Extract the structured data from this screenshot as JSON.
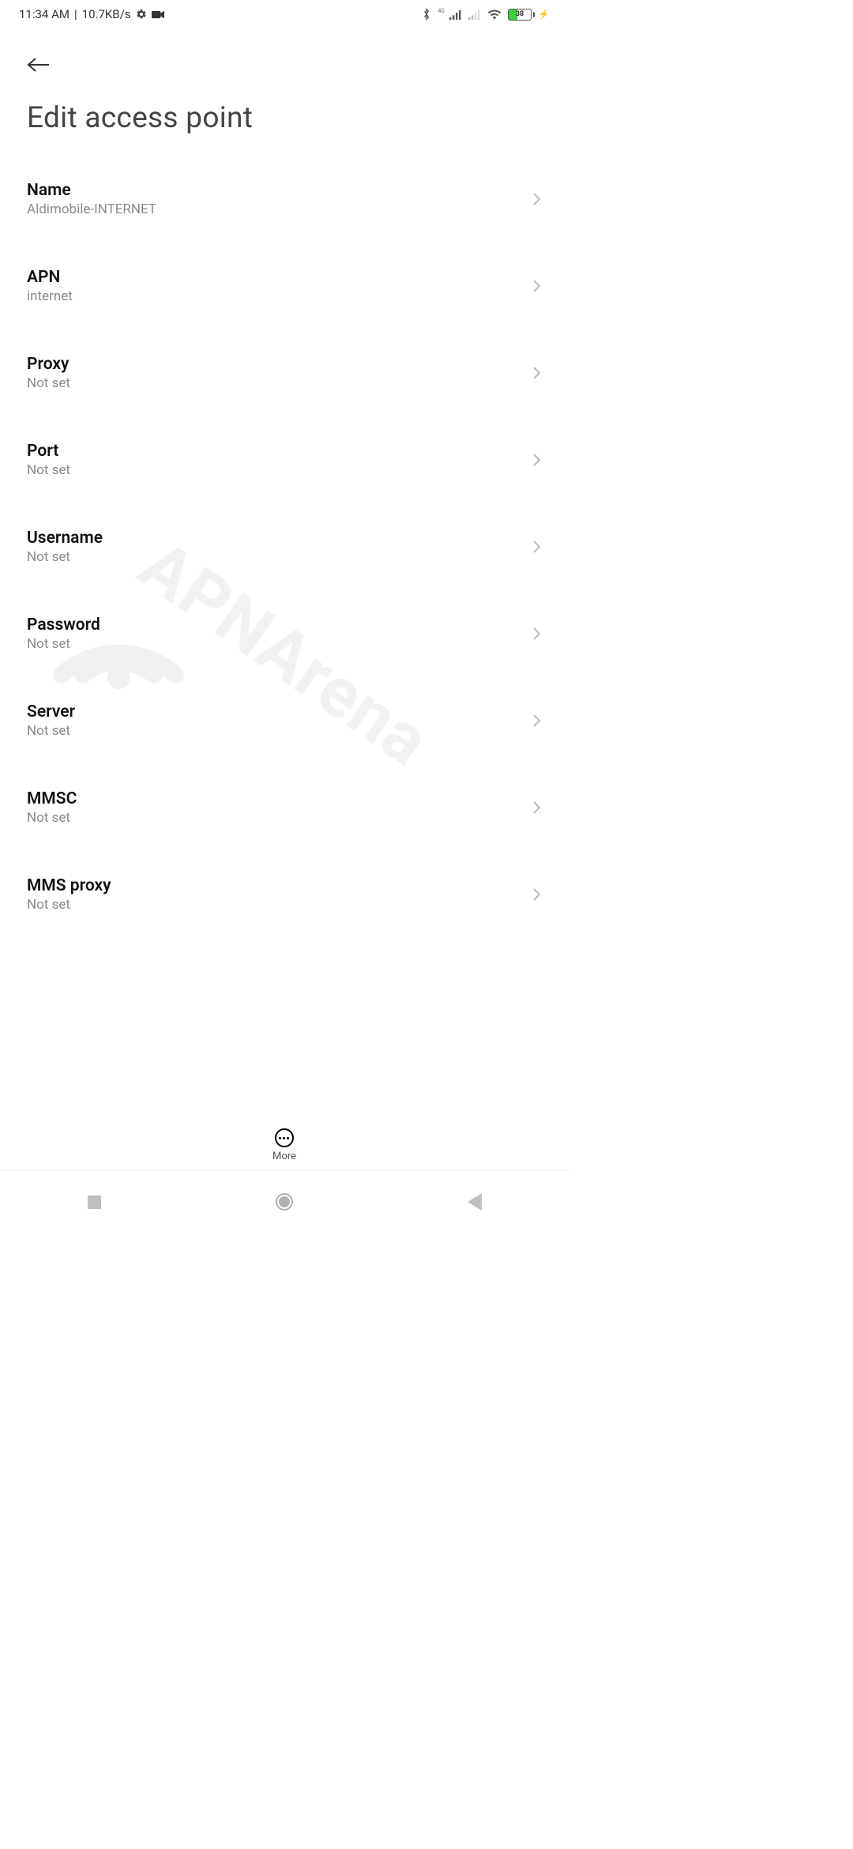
{
  "statusbar": {
    "time": "11:34 AM",
    "separator": "|",
    "speed": "10.7KB/s",
    "battery_pct": "38"
  },
  "header": {
    "title": "Edit access point"
  },
  "rows": [
    {
      "label": "Name",
      "value": "Aldimobile-INTERNET"
    },
    {
      "label": "APN",
      "value": "internet"
    },
    {
      "label": "Proxy",
      "value": "Not set"
    },
    {
      "label": "Port",
      "value": "Not set"
    },
    {
      "label": "Username",
      "value": "Not set"
    },
    {
      "label": "Password",
      "value": "Not set"
    },
    {
      "label": "Server",
      "value": "Not set"
    },
    {
      "label": "MMSC",
      "value": "Not set"
    },
    {
      "label": "MMS proxy",
      "value": "Not set"
    }
  ],
  "more": {
    "label": "More"
  },
  "watermark": {
    "text": "APNArena"
  }
}
